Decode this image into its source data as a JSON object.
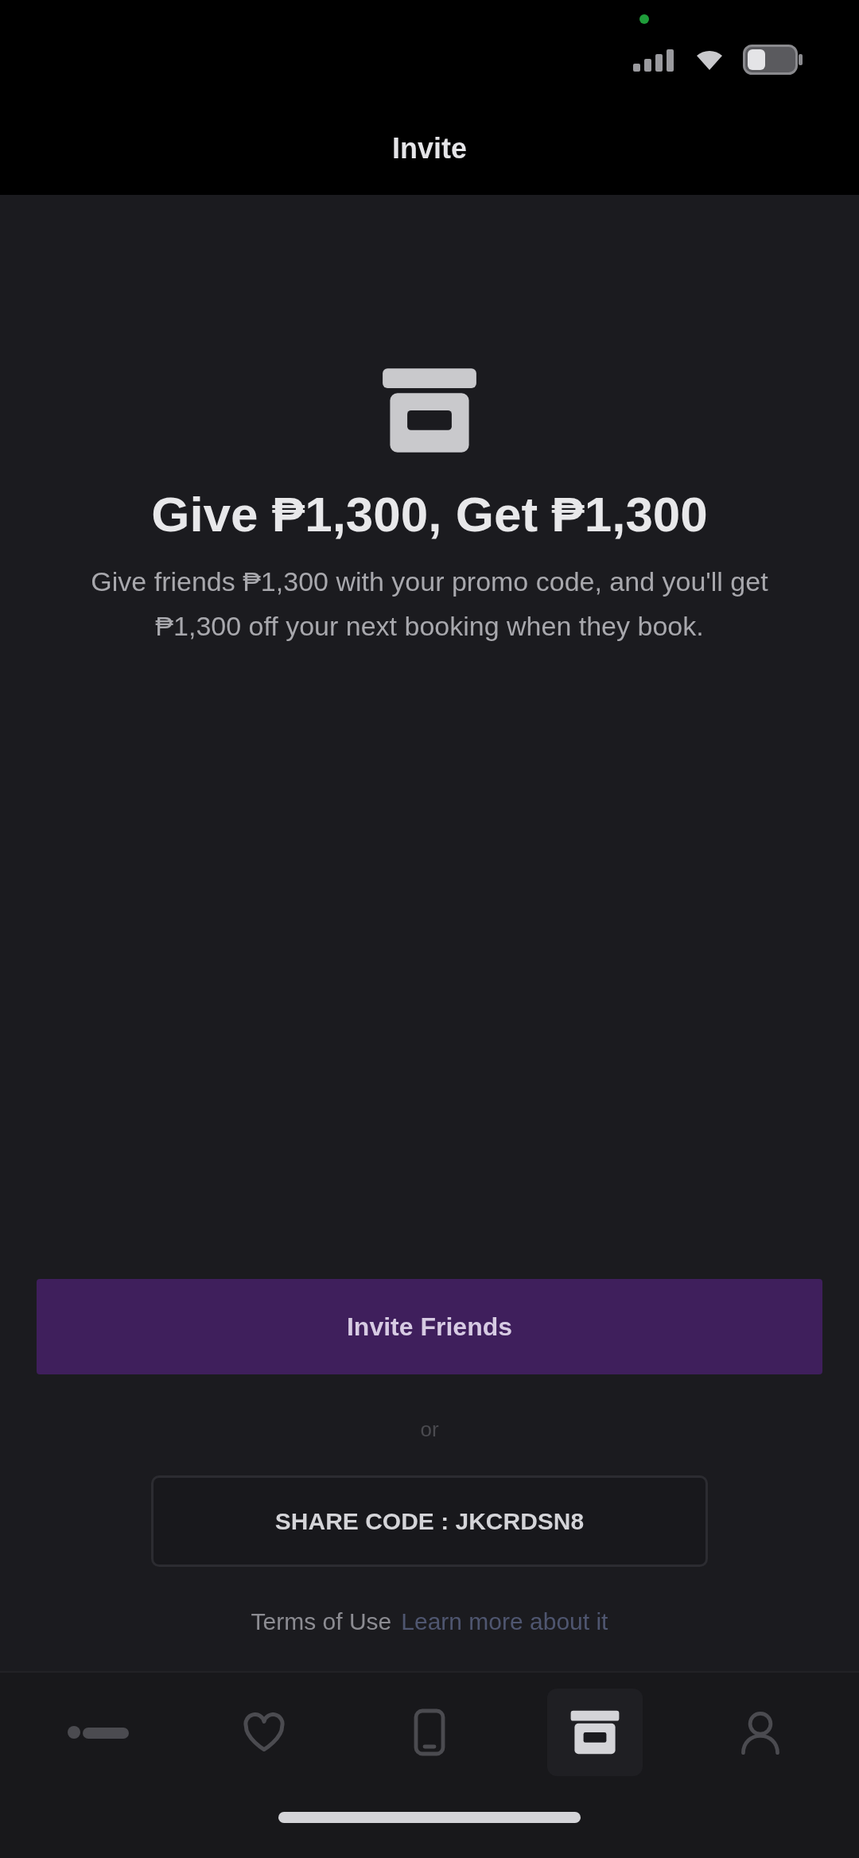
{
  "header": {
    "title": "Invite"
  },
  "promo": {
    "heading": "Give ₱1,300, Get ₱1,300",
    "description": "Give friends ₱1,300 with your promo code, and you'll get ₱1,300 off your next booking when they book."
  },
  "actions": {
    "primary_button": "Invite Friends",
    "separator": "or",
    "share_button": "SHARE CODE : JKCRDSN8"
  },
  "terms": {
    "text": "Terms of Use",
    "link": "Learn more about it"
  },
  "tab_bar": {
    "items": [
      {
        "kind": "logo",
        "selected": false
      },
      {
        "kind": "heart",
        "selected": false
      },
      {
        "kind": "phone",
        "selected": false
      },
      {
        "kind": "box",
        "selected": true
      },
      {
        "kind": "person",
        "selected": false
      }
    ]
  }
}
